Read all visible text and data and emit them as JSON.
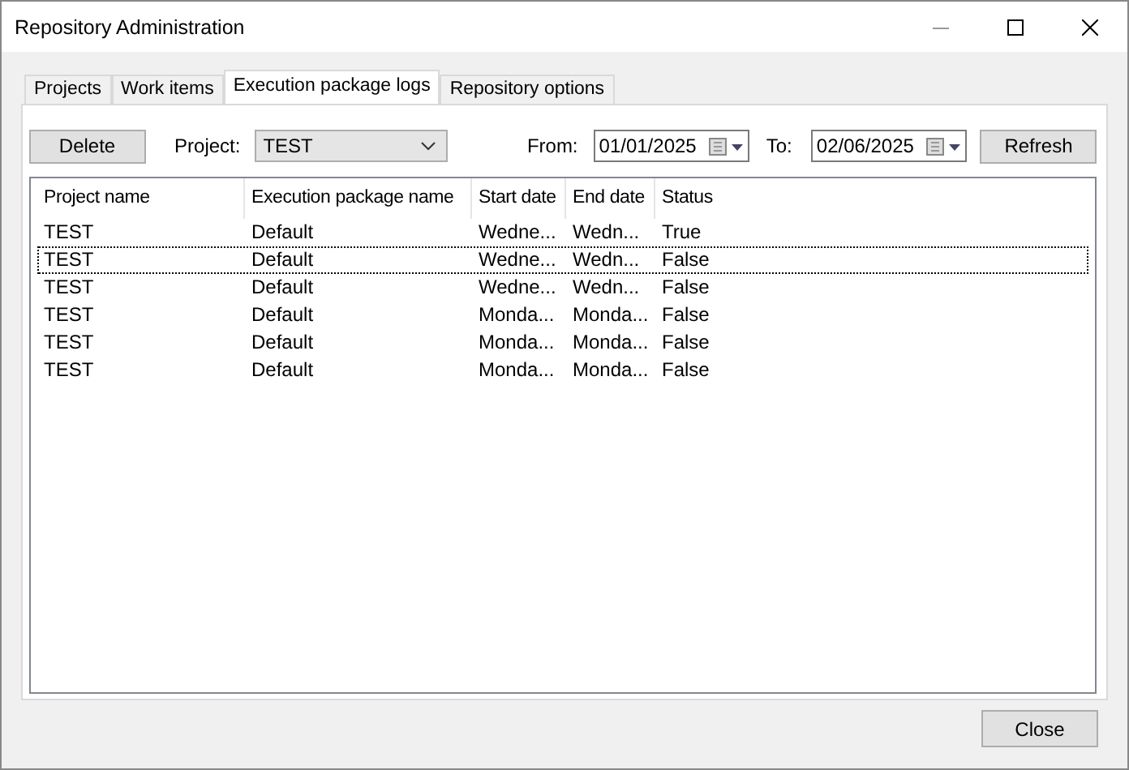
{
  "window": {
    "title": "Repository Administration"
  },
  "tabs": [
    {
      "label": "Projects",
      "selected": false
    },
    {
      "label": "Work items",
      "selected": false
    },
    {
      "label": "Execution package logs",
      "selected": true
    },
    {
      "label": "Repository options",
      "selected": false
    }
  ],
  "toolbar": {
    "delete_button": "Delete",
    "project_label": "Project:",
    "project_value": "TEST",
    "from_label": "From:",
    "from_value": "01/01/2025",
    "to_label": "To:",
    "to_value": "02/06/2025",
    "refresh_button": "Refresh"
  },
  "table": {
    "columns": [
      "Project name",
      "Execution package name",
      "Start date",
      "End date",
      "Status"
    ],
    "rows": [
      {
        "cells": [
          "TEST",
          "Default",
          "Wedne...",
          "Wedn...",
          "True"
        ],
        "focused": false
      },
      {
        "cells": [
          "TEST",
          "Default",
          "Wedne...",
          "Wedn...",
          "False"
        ],
        "focused": true
      },
      {
        "cells": [
          "TEST",
          "Default",
          "Wedne...",
          "Wedn...",
          "False"
        ],
        "focused": false
      },
      {
        "cells": [
          "TEST",
          "Default",
          "Monda...",
          "Monda...",
          "False"
        ],
        "focused": false
      },
      {
        "cells": [
          "TEST",
          "Default",
          "Monda...",
          "Monda...",
          "False"
        ],
        "focused": false
      },
      {
        "cells": [
          "TEST",
          "Default",
          "Monda...",
          "Monda...",
          "False"
        ],
        "focused": false
      }
    ]
  },
  "close_button": "Close"
}
